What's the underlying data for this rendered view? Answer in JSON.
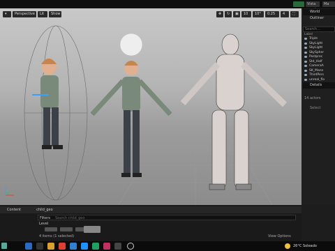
{
  "app": {
    "tabs": [
      "Vista previa",
      "Ma"
    ],
    "status_icon": "ue-status-icon"
  },
  "viewport": {
    "toolbar": {
      "view_mode": "Perspective",
      "lit": "Lit",
      "show": "Show",
      "grid_size": "10",
      "rotation_snap": "10°",
      "scale_snap": "0.25",
      "camera_speed": "4"
    }
  },
  "world_outliner": {
    "title": "World Outliner",
    "search_placeholder": "Search...",
    "column_label": "Label",
    "items": [
      {
        "label": "Triple",
        "selected": false
      },
      {
        "label": "SkyLight",
        "selected": false
      },
      {
        "label": "SkyLight",
        "selected": false
      },
      {
        "label": "SkySpher",
        "selected": false
      },
      {
        "label": "Postproc",
        "selected": false
      },
      {
        "label": "Std_Half",
        "selected": false
      },
      {
        "label": "CameraA",
        "selected": false
      },
      {
        "label": "SK_Mann",
        "selected": false
      },
      {
        "label": "ThirdPers",
        "selected": false
      },
      {
        "label": "unreal_flo",
        "selected": false
      }
    ],
    "actor_count": "14 actors",
    "details_title": "Details",
    "details_hint": "Select"
  },
  "content_browser": {
    "tab": "Content",
    "breadcrumb": [
      "Content",
      "child_geo"
    ],
    "filters_label": "Filters",
    "search_placeholder": "Search child_geo",
    "section": "Level",
    "status": "4 items (1 selected)",
    "view_options": "View Options"
  },
  "taskbar": {
    "weather": "26°C  Soleado",
    "colors": {
      "accent": "#1e90ff"
    }
  }
}
